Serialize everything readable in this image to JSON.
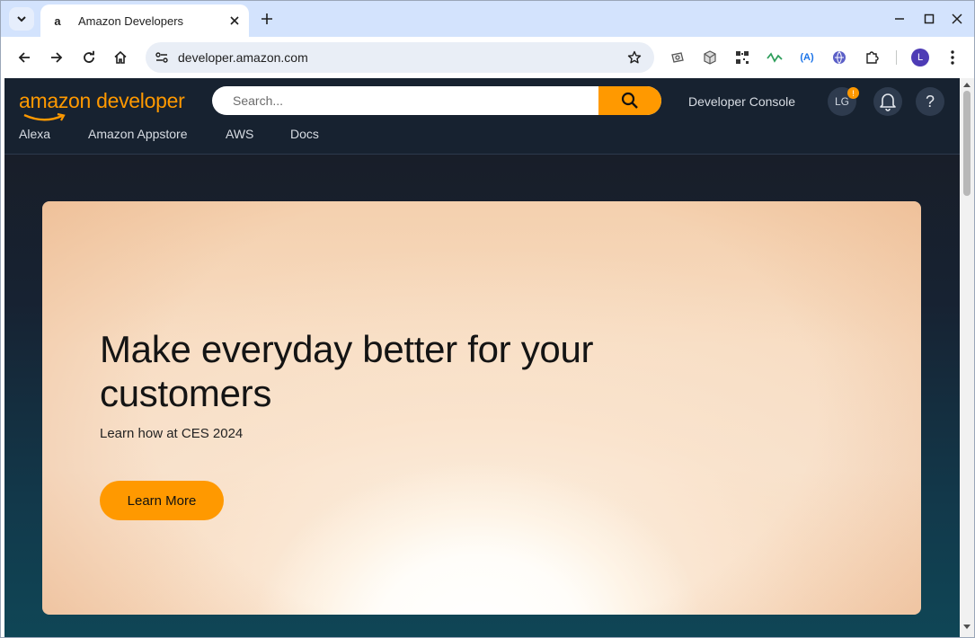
{
  "browser": {
    "tab": {
      "title": "Amazon Developers",
      "favicon_letter": "a"
    },
    "url": "developer.amazon.com",
    "profile_letter": "L",
    "extensions": [
      "camera-extension-icon",
      "cube-extension-icon",
      "qr-extension-icon",
      "wave-extension-icon",
      "a-extension-icon",
      "globe-extension-icon",
      "puzzle-icon"
    ]
  },
  "header": {
    "logo_text": "amazon developer",
    "search_placeholder": "Search...",
    "developer_console": "Developer Console",
    "avatar_initials": "LG",
    "avatar_badge": "!",
    "help_label": "?"
  },
  "nav": {
    "items": [
      "Alexa",
      "Amazon Appstore",
      "AWS",
      "Docs"
    ]
  },
  "hero": {
    "title": "Make everyday better for your customers",
    "subtitle": "Learn how at CES 2024",
    "cta_label": "Learn More"
  },
  "colors": {
    "accent": "#ff9900",
    "header_bg": "#172230",
    "tab_strip": "#d3e3fd"
  }
}
